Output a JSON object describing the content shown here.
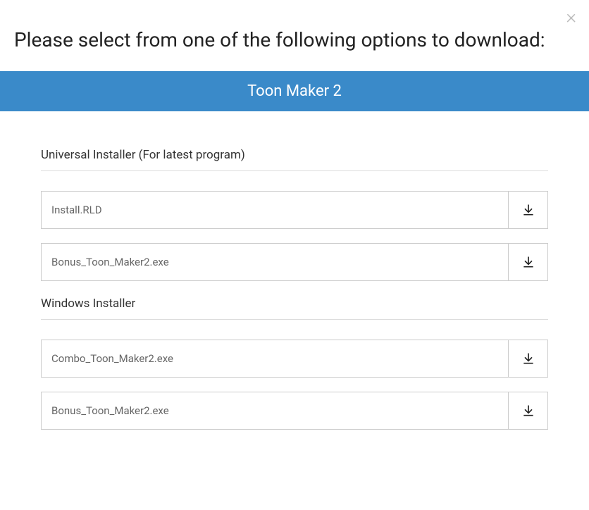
{
  "heading": "Please select from one of the following options to download:",
  "banner": "Toon Maker 2",
  "sections": [
    {
      "title": "Universal Installer (For latest program)",
      "items": [
        {
          "label": "Install.RLD"
        },
        {
          "label": "Bonus_Toon_Maker2.exe"
        }
      ]
    },
    {
      "title": "Windows Installer",
      "items": [
        {
          "label": "Combo_Toon_Maker2.exe"
        },
        {
          "label": "Bonus_Toon_Maker2.exe"
        }
      ]
    }
  ]
}
